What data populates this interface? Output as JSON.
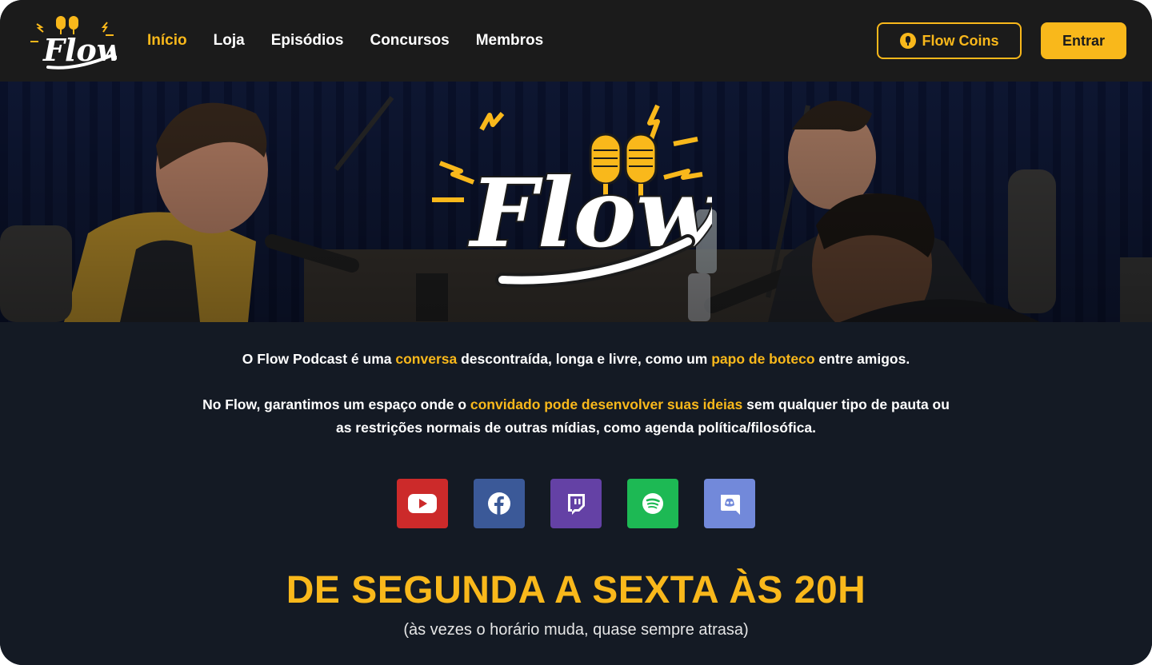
{
  "brand": {
    "name": "Flow",
    "accent": "#f9b81b",
    "header_bg": "#1b1b1b",
    "page_bg": "#141a24"
  },
  "nav": {
    "items": [
      {
        "label": "Início",
        "active": true
      },
      {
        "label": "Loja"
      },
      {
        "label": "Episódios"
      },
      {
        "label": "Concursos"
      },
      {
        "label": "Membros"
      }
    ]
  },
  "header_actions": {
    "coins_label": "Flow Coins",
    "coins_icon": "coin-icon",
    "enter_label": "Entrar"
  },
  "hero": {
    "logo_text": "Flow"
  },
  "intro": {
    "p1": [
      {
        "t": "O Flow Podcast é uma "
      },
      {
        "t": "conversa",
        "hl": true
      },
      {
        "t": " descontraída, longa e livre, como um "
      },
      {
        "t": "papo de boteco",
        "hl": true
      },
      {
        "t": " entre amigos."
      }
    ],
    "p2_line1": [
      {
        "t": "No Flow, garantimos um espaço onde o "
      },
      {
        "t": "convidado pode desenvolver suas ideias",
        "hl": true
      },
      {
        "t": " sem qualquer tipo de pauta ou"
      }
    ],
    "p2_line2": "as restrições normais de outras mídias, como agenda política/filosófica."
  },
  "socials": [
    {
      "name": "youtube",
      "icon": "youtube-icon",
      "color": "#cc2a2a"
    },
    {
      "name": "facebook",
      "icon": "facebook-icon",
      "color": "#3b5998"
    },
    {
      "name": "twitch",
      "icon": "twitch-icon",
      "color": "#6441a5"
    },
    {
      "name": "spotify",
      "icon": "spotify-icon",
      "color": "#1db954"
    },
    {
      "name": "discord",
      "icon": "discord-icon",
      "color": "#7289da"
    }
  ],
  "schedule": {
    "title": "DE SEGUNDA A SEXTA ÀS 20H",
    "subtitle": "(às vezes o horário muda, quase sempre atrasa)"
  }
}
